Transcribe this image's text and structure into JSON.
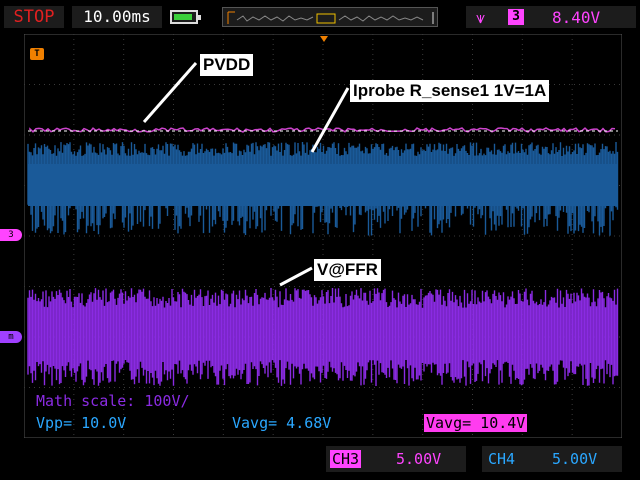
{
  "top_bar": {
    "run_state": "STOP",
    "timebase": "10.00ms",
    "battery_icon": "battery-icon",
    "trigger_channel": "3",
    "trigger_level": "8.40V"
  },
  "annotations": {
    "pvdd": "PVDD",
    "iprobe": "Iprobe R_sense1 1V=1A",
    "vffr": "V@FFR"
  },
  "markers": {
    "trigger_pos": "T",
    "ch3": "3",
    "math": "m"
  },
  "measurements": {
    "math_scale": "Math scale: 100V/",
    "vpp": "Vpp= 10.0V",
    "vavg_ch4": "Vavg= 4.68V",
    "vavg_ch3": "Vavg= 10.4V"
  },
  "channels": [
    {
      "label": "CH3",
      "value": "5.00V",
      "color": "#ff44ff"
    },
    {
      "label": "CH4",
      "value": "5.00V",
      "color": "#2aa7ff"
    }
  ],
  "colors": {
    "pvdd_trace": "#cc44cc",
    "ch4_trace": "#1a5a99",
    "math_trace": "#8a2be2",
    "grid": "#3a3a3a"
  }
}
